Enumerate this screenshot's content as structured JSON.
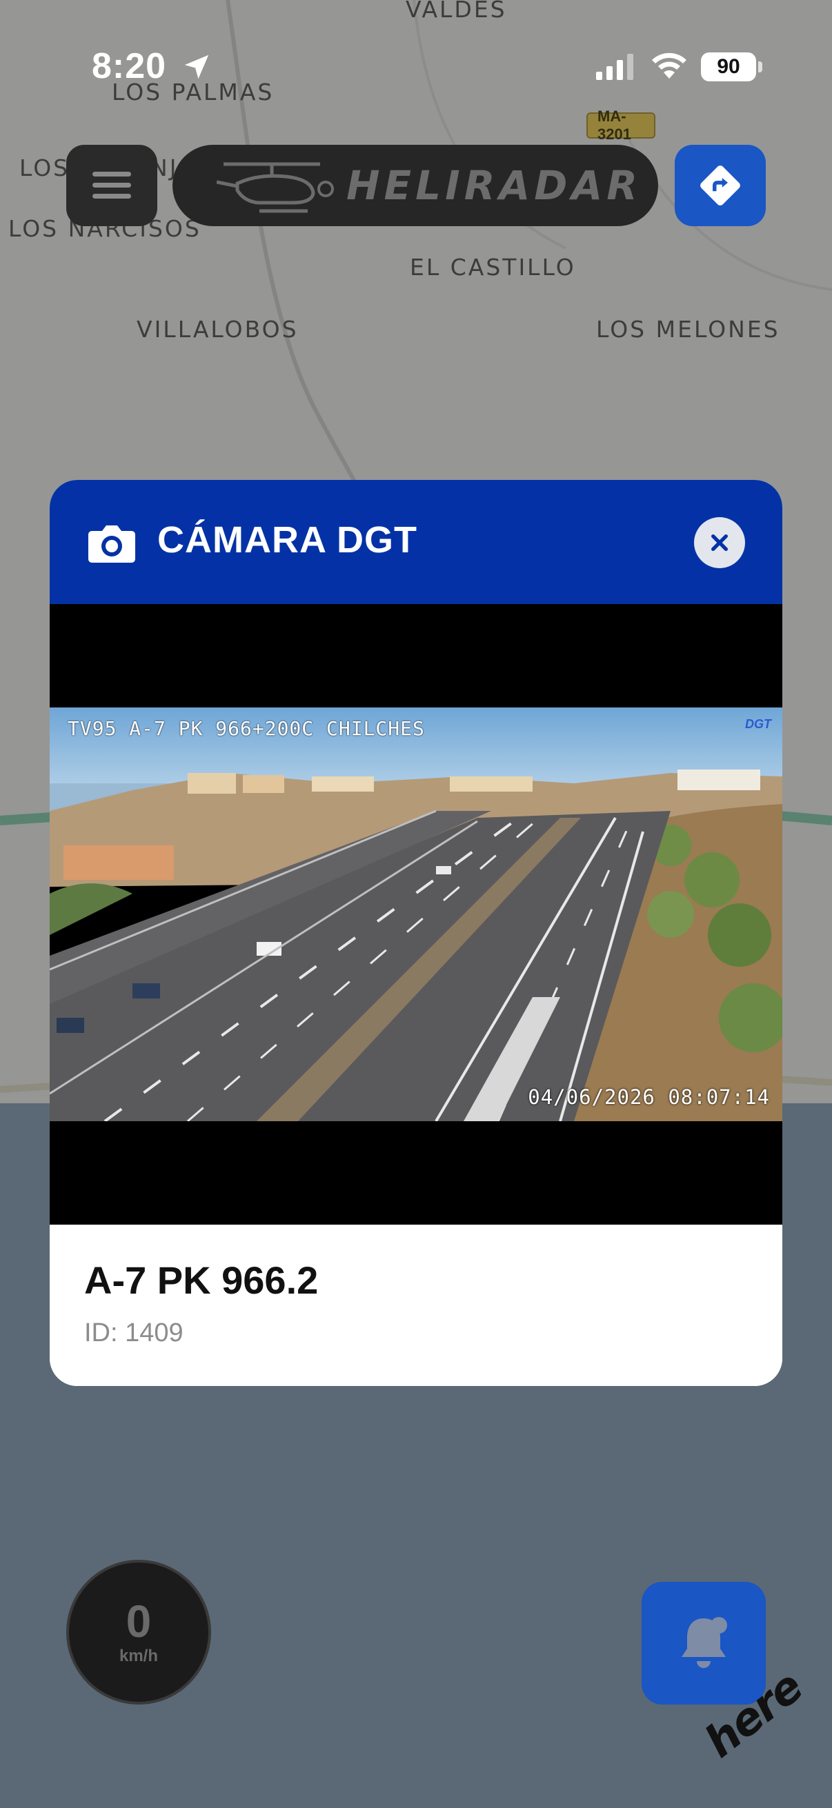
{
  "status_bar": {
    "time": "8:20",
    "battery": "90"
  },
  "map": {
    "places": [
      "VALDÉS",
      "LOS PALMAS",
      "LOS NARANJOS",
      "LOS NARCISOS",
      "EL CASTILLO",
      "VILLALOBOS",
      "LOS MELONES"
    ],
    "road_badge": "MA-3201"
  },
  "header": {
    "app_logo_text": "HELIRADAR"
  },
  "modal": {
    "title": "CÁMARA DGT",
    "camera_overlay_top": "TV95 A-7 PK 966+200C CHILCHES",
    "camera_overlay_logo": "DGT",
    "camera_overlay_timestamp": "04/06/2026 08:07:14",
    "camera_name": "A-7 PK 966.2",
    "camera_id": "ID: 1409"
  },
  "speedometer": {
    "value": "0",
    "unit": "km/h"
  },
  "map_attribution": "here",
  "colors": {
    "accent_blue": "#1a56c4",
    "header_blue": "#0432a6"
  },
  "icons": [
    "location-arrow-icon",
    "cellular-signal-icon",
    "wifi-icon",
    "battery-icon",
    "hamburger-menu-icon",
    "helicopter-icon",
    "route-turn-icon",
    "camera-icon",
    "close-icon",
    "bell-icon"
  ]
}
